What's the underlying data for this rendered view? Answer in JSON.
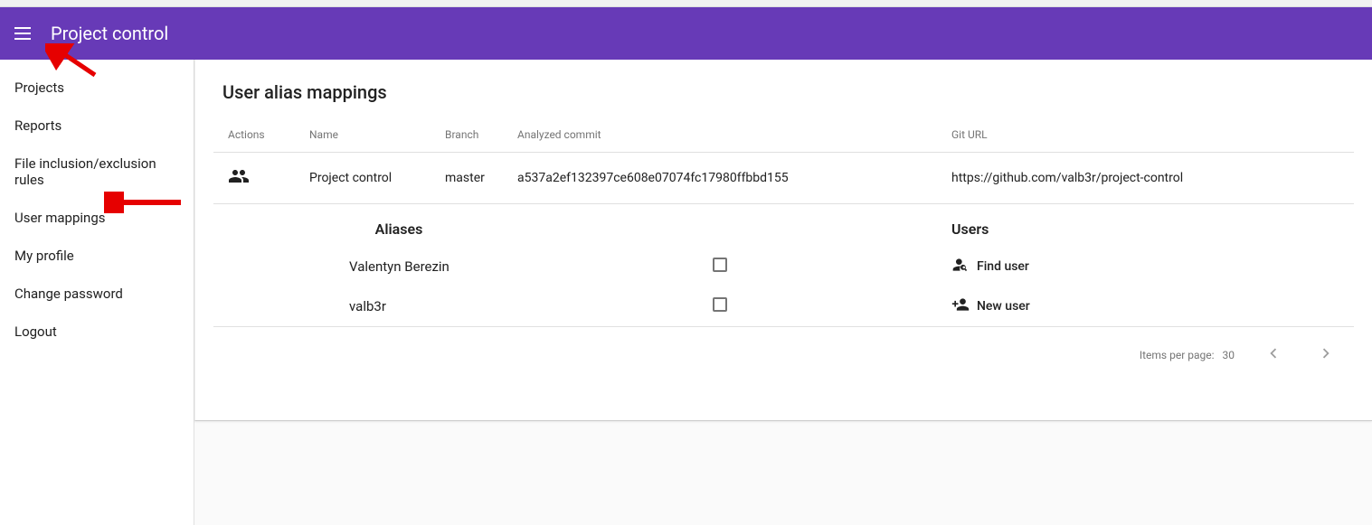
{
  "header": {
    "title": "Project control"
  },
  "sidebar": {
    "items": [
      {
        "label": "Projects"
      },
      {
        "label": "Reports"
      },
      {
        "label": "File inclusion/exclusion rules"
      },
      {
        "label": "User mappings"
      },
      {
        "label": "My profile"
      },
      {
        "label": "Change password"
      },
      {
        "label": "Logout"
      }
    ]
  },
  "page": {
    "title": "User alias mappings"
  },
  "table": {
    "columns": {
      "actions": "Actions",
      "name": "Name",
      "branch": "Branch",
      "commit": "Analyzed commit",
      "giturl": "Git URL"
    },
    "row": {
      "name": "Project control",
      "branch": "master",
      "commit": "a537a2ef132397ce608e07074fc17980ffbbd155",
      "giturl": "https://github.com/valb3r/project-control"
    },
    "sub": {
      "aliases_header": "Aliases",
      "users_header": "Users",
      "aliases": [
        {
          "name": "Valentyn Berezin"
        },
        {
          "name": "valb3r"
        }
      ],
      "actions": {
        "find": "Find user",
        "new": "New user"
      }
    }
  },
  "paginator": {
    "label": "Items per page:",
    "size": "30"
  }
}
